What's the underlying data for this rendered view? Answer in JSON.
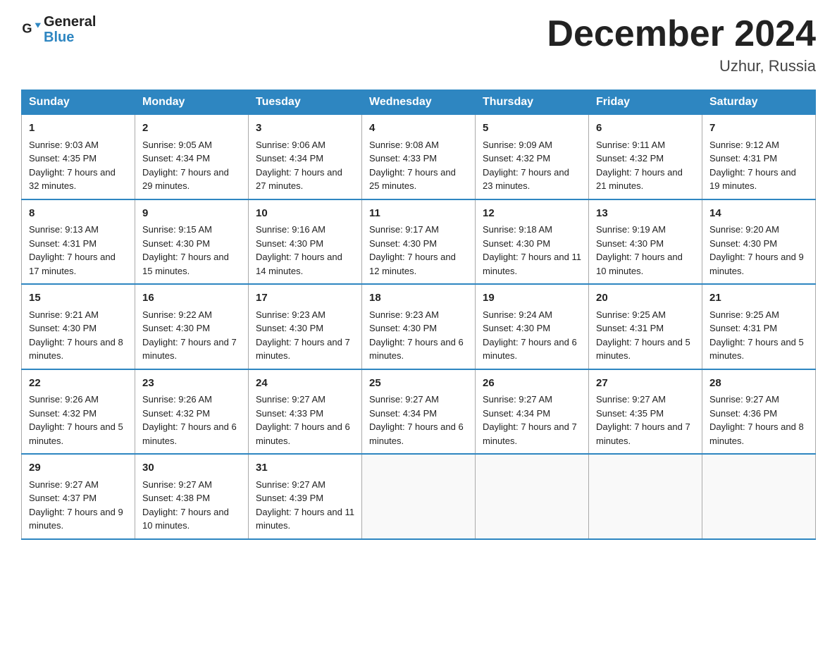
{
  "header": {
    "logo_general": "General",
    "logo_blue": "Blue",
    "month_title": "December 2024",
    "location": "Uzhur, Russia"
  },
  "days_of_week": [
    "Sunday",
    "Monday",
    "Tuesday",
    "Wednesday",
    "Thursday",
    "Friday",
    "Saturday"
  ],
  "weeks": [
    [
      {
        "day": "1",
        "sunrise": "Sunrise: 9:03 AM",
        "sunset": "Sunset: 4:35 PM",
        "daylight": "Daylight: 7 hours and 32 minutes."
      },
      {
        "day": "2",
        "sunrise": "Sunrise: 9:05 AM",
        "sunset": "Sunset: 4:34 PM",
        "daylight": "Daylight: 7 hours and 29 minutes."
      },
      {
        "day": "3",
        "sunrise": "Sunrise: 9:06 AM",
        "sunset": "Sunset: 4:34 PM",
        "daylight": "Daylight: 7 hours and 27 minutes."
      },
      {
        "day": "4",
        "sunrise": "Sunrise: 9:08 AM",
        "sunset": "Sunset: 4:33 PM",
        "daylight": "Daylight: 7 hours and 25 minutes."
      },
      {
        "day": "5",
        "sunrise": "Sunrise: 9:09 AM",
        "sunset": "Sunset: 4:32 PM",
        "daylight": "Daylight: 7 hours and 23 minutes."
      },
      {
        "day": "6",
        "sunrise": "Sunrise: 9:11 AM",
        "sunset": "Sunset: 4:32 PM",
        "daylight": "Daylight: 7 hours and 21 minutes."
      },
      {
        "day": "7",
        "sunrise": "Sunrise: 9:12 AM",
        "sunset": "Sunset: 4:31 PM",
        "daylight": "Daylight: 7 hours and 19 minutes."
      }
    ],
    [
      {
        "day": "8",
        "sunrise": "Sunrise: 9:13 AM",
        "sunset": "Sunset: 4:31 PM",
        "daylight": "Daylight: 7 hours and 17 minutes."
      },
      {
        "day": "9",
        "sunrise": "Sunrise: 9:15 AM",
        "sunset": "Sunset: 4:30 PM",
        "daylight": "Daylight: 7 hours and 15 minutes."
      },
      {
        "day": "10",
        "sunrise": "Sunrise: 9:16 AM",
        "sunset": "Sunset: 4:30 PM",
        "daylight": "Daylight: 7 hours and 14 minutes."
      },
      {
        "day": "11",
        "sunrise": "Sunrise: 9:17 AM",
        "sunset": "Sunset: 4:30 PM",
        "daylight": "Daylight: 7 hours and 12 minutes."
      },
      {
        "day": "12",
        "sunrise": "Sunrise: 9:18 AM",
        "sunset": "Sunset: 4:30 PM",
        "daylight": "Daylight: 7 hours and 11 minutes."
      },
      {
        "day": "13",
        "sunrise": "Sunrise: 9:19 AM",
        "sunset": "Sunset: 4:30 PM",
        "daylight": "Daylight: 7 hours and 10 minutes."
      },
      {
        "day": "14",
        "sunrise": "Sunrise: 9:20 AM",
        "sunset": "Sunset: 4:30 PM",
        "daylight": "Daylight: 7 hours and 9 minutes."
      }
    ],
    [
      {
        "day": "15",
        "sunrise": "Sunrise: 9:21 AM",
        "sunset": "Sunset: 4:30 PM",
        "daylight": "Daylight: 7 hours and 8 minutes."
      },
      {
        "day": "16",
        "sunrise": "Sunrise: 9:22 AM",
        "sunset": "Sunset: 4:30 PM",
        "daylight": "Daylight: 7 hours and 7 minutes."
      },
      {
        "day": "17",
        "sunrise": "Sunrise: 9:23 AM",
        "sunset": "Sunset: 4:30 PM",
        "daylight": "Daylight: 7 hours and 7 minutes."
      },
      {
        "day": "18",
        "sunrise": "Sunrise: 9:23 AM",
        "sunset": "Sunset: 4:30 PM",
        "daylight": "Daylight: 7 hours and 6 minutes."
      },
      {
        "day": "19",
        "sunrise": "Sunrise: 9:24 AM",
        "sunset": "Sunset: 4:30 PM",
        "daylight": "Daylight: 7 hours and 6 minutes."
      },
      {
        "day": "20",
        "sunrise": "Sunrise: 9:25 AM",
        "sunset": "Sunset: 4:31 PM",
        "daylight": "Daylight: 7 hours and 5 minutes."
      },
      {
        "day": "21",
        "sunrise": "Sunrise: 9:25 AM",
        "sunset": "Sunset: 4:31 PM",
        "daylight": "Daylight: 7 hours and 5 minutes."
      }
    ],
    [
      {
        "day": "22",
        "sunrise": "Sunrise: 9:26 AM",
        "sunset": "Sunset: 4:32 PM",
        "daylight": "Daylight: 7 hours and 5 minutes."
      },
      {
        "day": "23",
        "sunrise": "Sunrise: 9:26 AM",
        "sunset": "Sunset: 4:32 PM",
        "daylight": "Daylight: 7 hours and 6 minutes."
      },
      {
        "day": "24",
        "sunrise": "Sunrise: 9:27 AM",
        "sunset": "Sunset: 4:33 PM",
        "daylight": "Daylight: 7 hours and 6 minutes."
      },
      {
        "day": "25",
        "sunrise": "Sunrise: 9:27 AM",
        "sunset": "Sunset: 4:34 PM",
        "daylight": "Daylight: 7 hours and 6 minutes."
      },
      {
        "day": "26",
        "sunrise": "Sunrise: 9:27 AM",
        "sunset": "Sunset: 4:34 PM",
        "daylight": "Daylight: 7 hours and 7 minutes."
      },
      {
        "day": "27",
        "sunrise": "Sunrise: 9:27 AM",
        "sunset": "Sunset: 4:35 PM",
        "daylight": "Daylight: 7 hours and 7 minutes."
      },
      {
        "day": "28",
        "sunrise": "Sunrise: 9:27 AM",
        "sunset": "Sunset: 4:36 PM",
        "daylight": "Daylight: 7 hours and 8 minutes."
      }
    ],
    [
      {
        "day": "29",
        "sunrise": "Sunrise: 9:27 AM",
        "sunset": "Sunset: 4:37 PM",
        "daylight": "Daylight: 7 hours and 9 minutes."
      },
      {
        "day": "30",
        "sunrise": "Sunrise: 9:27 AM",
        "sunset": "Sunset: 4:38 PM",
        "daylight": "Daylight: 7 hours and 10 minutes."
      },
      {
        "day": "31",
        "sunrise": "Sunrise: 9:27 AM",
        "sunset": "Sunset: 4:39 PM",
        "daylight": "Daylight: 7 hours and 11 minutes."
      },
      null,
      null,
      null,
      null
    ]
  ]
}
